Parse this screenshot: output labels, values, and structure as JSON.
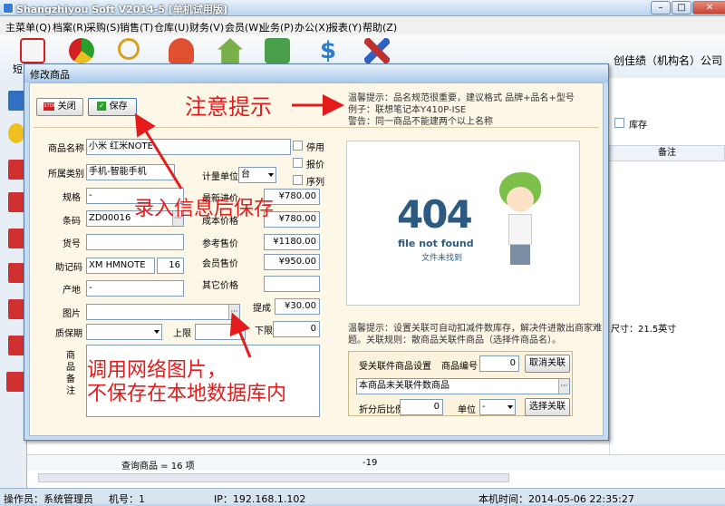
{
  "window": {
    "title": "Shangzhiyou Soft V2014-5 [单机试用版]",
    "min": "–",
    "max": "□",
    "close": "✕"
  },
  "menu": [
    "主菜单(Q)",
    "档案(R)",
    "采购(S)",
    "销售(T)",
    "仓库(U)",
    "财务(V)",
    "会员(W)",
    "业务(P)",
    "办公(X)",
    "报表(Y)",
    "帮助(Z)"
  ],
  "toolbar": {
    "first_label": "短",
    "company": "创佳绩（机构名）公司"
  },
  "bg": {
    "stock_label": "库存",
    "remark_header": "备注",
    "size_text": "尺寸：21.5英寸",
    "query_text": "查询商品 = 16 项",
    "query_value": "-19"
  },
  "dialog": {
    "title": "修改商品",
    "close_label": "关闭",
    "save_label": "保存",
    "hint1": "温馨提示：品名规范很重要，建议格式 品牌+品名+型号",
    "hint2": "例子：联想笔记本Y410P-ISE",
    "hint3": "警告：同一商品不能建两个以上名称",
    "labels": {
      "name": "商品名称",
      "category": "所属类别",
      "spec": "规格",
      "barcode": "条码",
      "item_no": "货号",
      "mnemonic": "助记码",
      "origin": "产地",
      "image": "图片",
      "warranty": "质保期",
      "upper": "上限",
      "lower": "下限",
      "unit": "计量单位",
      "latest_price": "最新进价",
      "cost": "成本价格",
      "ref_price": "参考售价",
      "member_price": "会员售价",
      "other_price": "其它价格",
      "commission": "提成",
      "remark": "商品备注",
      "disabled": "停用",
      "report_price": "报价",
      "serial": "序列"
    },
    "values": {
      "name": "小米 红米NOTE",
      "category": "手机-智能手机",
      "spec": "-",
      "barcode": "ZD00016",
      "item_no": "",
      "mnemonic": "XM HMNOTE",
      "mnemonic_len": "16",
      "origin": "-",
      "image": "",
      "warranty": "",
      "upper": "",
      "lower": "0",
      "unit": "台",
      "latest_price": "¥780.00",
      "cost": "¥780.00",
      "ref_price": "¥1180.00",
      "member_price": "¥950.00",
      "other_price": "",
      "commission": "¥30.00"
    },
    "image": {
      "code": "404",
      "caption": "file not found",
      "subcaption": "文件未找到"
    },
    "link": {
      "hint": "温馨提示：设置关联可自动扣减件数库存，解决件进散出商家难题。关联规则：散商品关联件商品（选择件商品名）。",
      "section": "受关联件商品设置",
      "item_no_label": "商品编号",
      "item_no": "0",
      "cancel_btn": "取消关联",
      "product": "本商品未关联件数商品",
      "ratio_label": "折分后比例",
      "ratio": "0",
      "unit_label": "单位",
      "unit": "-",
      "select_btn": "选择关联"
    }
  },
  "annotations": {
    "hint": "注意提示",
    "save": "录入信息后保存",
    "net_image_1": "调用网络图片，",
    "net_image_2": "不保存在本地数据库内"
  },
  "status": {
    "operator": "操作员：系统管理员",
    "machine": "机号：1",
    "ip": "IP：192.168.1.102",
    "time": "本机时间：2014-05-06 22:35:27"
  }
}
